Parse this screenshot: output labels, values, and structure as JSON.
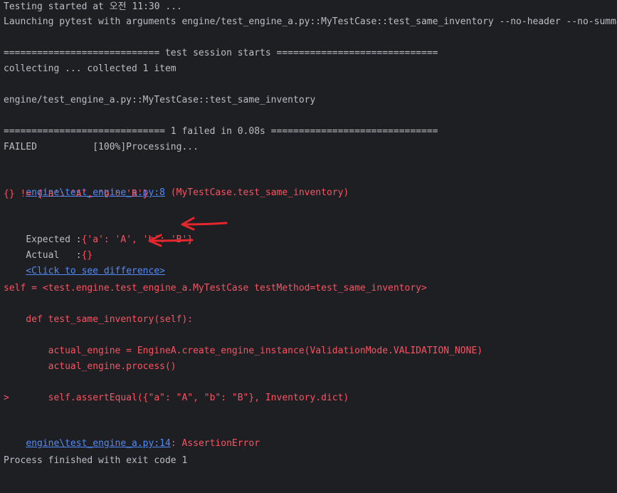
{
  "console": {
    "l1": "Testing started at 오전 11:30 ...",
    "l2": "Launching pytest with arguments engine/test_engine_a.py::MyTestCase::test_same_inventory --no-header --no-summary -q",
    "l3": "============================ test session starts =============================",
    "l4": "collecting ... collected 1 item",
    "l5": "engine/test_engine_a.py::MyTestCase::test_same_inventory",
    "l6": "============================= 1 failed in 0.08s ==============================",
    "l7": "FAILED          [100%]Processing...",
    "l8_link": "engine\\test_engine_a.py:8",
    "l8_rest": " (MyTestCase.test_same_inventory)",
    "l9": "{} != {'a': 'A', 'b': 'B'}",
    "l10_label": "Expected :",
    "l10_value": "{'a': 'A', 'b': 'B'}",
    "l11_label": "Actual   :",
    "l11_value": "{}",
    "l12_link": "<Click to see difference>",
    "l13": "self = <test.engine.test_engine_a.MyTestCase testMethod=test_same_inventory>",
    "l14": "    def test_same_inventory(self):",
    "l15": "        actual_engine = EngineA.create_engine_instance(ValidationMode.VALIDATION_NONE)",
    "l16": "        actual_engine.process()",
    "l17": ">       self.assertEqual({\"a\": \"A\", \"b\": \"B\"}, Inventory.dict)",
    "l18_link": "engine\\test_engine_a.py:14",
    "l18_rest": ": AssertionError",
    "l19": "Process finished with exit code 1"
  },
  "colors": {
    "background": "#1e1f22",
    "text": "#bcbec4",
    "error": "#f75464",
    "link": "#548af7",
    "annotation_arrow": "#e5272d"
  }
}
